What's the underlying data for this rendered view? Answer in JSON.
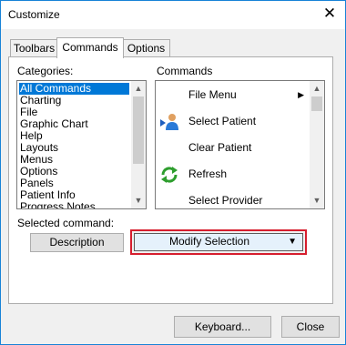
{
  "window": {
    "title": "Customize",
    "close_glyph": "✕"
  },
  "tabs": [
    {
      "label": "Toolbars",
      "active": false
    },
    {
      "label": "Commands",
      "active": true
    },
    {
      "label": "Options",
      "active": false
    }
  ],
  "categories": {
    "label": "Categories:",
    "items": [
      "All Commands",
      "Charting",
      "File",
      "Graphic Chart",
      "Help",
      "Layouts",
      "Menus",
      "Options",
      "Panels",
      "Patient Info",
      "Progress Notes"
    ],
    "selected": "All Commands"
  },
  "commands": {
    "label": "Commands",
    "items": [
      {
        "label": "File Menu",
        "icon": "none",
        "submenu": true
      },
      {
        "label": "Select Patient",
        "icon": "select-patient-icon",
        "submenu": false
      },
      {
        "label": "Clear Patient",
        "icon": "none",
        "submenu": false
      },
      {
        "label": "Refresh",
        "icon": "refresh-icon",
        "submenu": false
      },
      {
        "label": "Select Provider",
        "icon": "none",
        "submenu": false
      }
    ],
    "submenu_glyph": "▶"
  },
  "selected_command": {
    "label": "Selected command:"
  },
  "buttons": {
    "description": "Description",
    "modify_selection": "Modify Selection",
    "modify_arrow": "▼",
    "keyboard": "Keyboard...",
    "close": "Close"
  },
  "scroll_glyphs": {
    "up": "▲",
    "down": "▼"
  },
  "colors": {
    "selection": "#0078d7",
    "focus_outline": "#d61e2e",
    "window_border": "#1883d7"
  }
}
